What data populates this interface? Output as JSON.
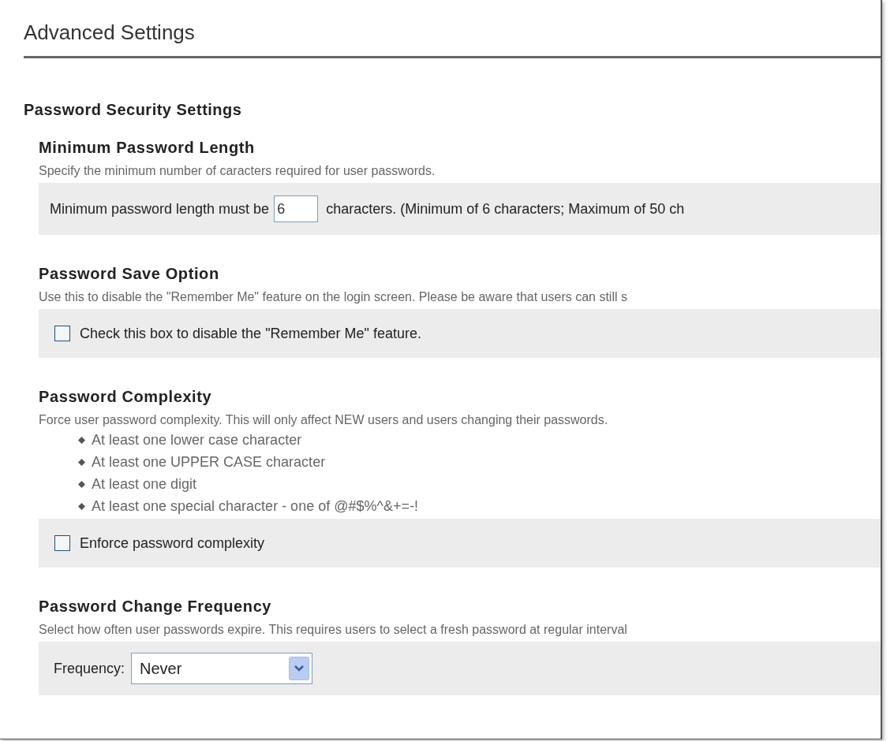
{
  "page_title": "Advanced Settings",
  "group_title": "Password Security Settings",
  "sections": [
    {
      "kind": "number",
      "title": "Minimum Password Length",
      "description": "Specify the minimum number of caracters required for user passwords.",
      "label_before": "Minimum password length must be",
      "value": "6",
      "label_after": "characters. (Minimum of 6 characters; Maximum of 50 ch"
    },
    {
      "kind": "checkbox",
      "title": "Password Save Option",
      "description": "Use this to disable the \"Remember Me\" feature on the login screen. Please be aware that users can still s",
      "checked": false,
      "label": "Check this box to disable the \"Remember Me\" feature."
    },
    {
      "kind": "checkbox",
      "title": "Password Complexity",
      "description": "Force user password complexity. This will only affect NEW users and users changing their passwords.",
      "bullets": [
        "At least one lower case character",
        "At least one UPPER CASE character",
        "At least one digit",
        "At least one special character - one of @#$%^&+=-!"
      ],
      "checked": false,
      "label": "Enforce password complexity"
    },
    {
      "kind": "select",
      "title": "Password Change Frequency",
      "description": "Select how often user passwords expire. This requires users to select a fresh password at regular interval",
      "label": "Frequency:",
      "value": "Never"
    }
  ]
}
